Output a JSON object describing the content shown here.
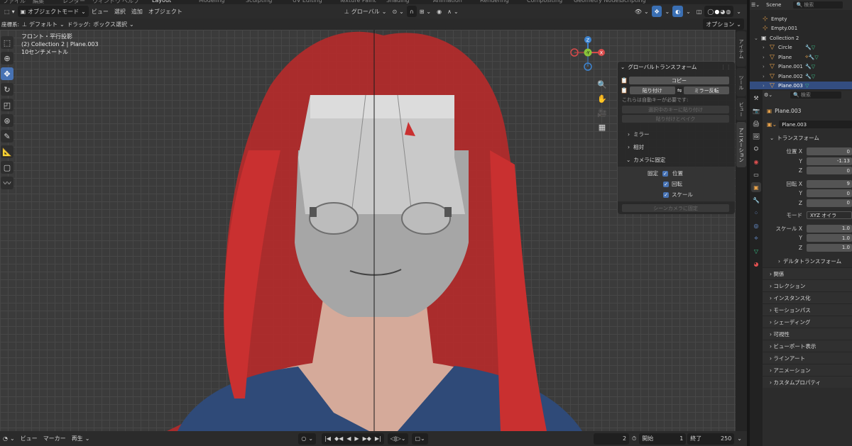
{
  "workspaces": [
    "ファイル",
    "編集",
    "レンダー",
    "ウィンドウ",
    "ヘルプ",
    "Layout",
    "Modeling",
    "Sculpting",
    "UV Editing",
    "Texture Paint",
    "Shading",
    "Animation",
    "Rendering",
    "Compositing",
    "Geometry Nodes",
    "Scripting"
  ],
  "viewport_header": {
    "mode": "オブジェクトモード",
    "menus": [
      "ビュー",
      "選択",
      "追加",
      "オブジェクト"
    ],
    "transform_orientation": "グローバル",
    "options_label": "オプション"
  },
  "tool_header": {
    "orientation_label": "座標系:",
    "orientation_value": "デフォルト",
    "drag_label": "ドラッグ:",
    "drag_value": "ボックス選択"
  },
  "viewport_info": {
    "view_name": "フロント・平行投影",
    "collection_object": "(2) Collection 2 | Plane.003",
    "scale_text": "10センチメートル"
  },
  "gizmo": {
    "z": "Z",
    "y": "-Y",
    "x": "X"
  },
  "npanel": {
    "title": "グローバルトランスフォーム",
    "copy": "コピー",
    "paste": "貼り付け",
    "mirror": "ミラー反転",
    "note": "これらは自動キーが必要です:",
    "paste_selected": "選択中のキーに貼り付け",
    "paste_bake": "貼り付けとベイク",
    "sections": [
      "ミラー",
      "相対",
      "カメラに固定"
    ],
    "fix_label": "固定",
    "checks": [
      "位置",
      "回転",
      "スケール"
    ],
    "scene_camera": "シーンカメラに固定"
  },
  "side_tabs": [
    "アイテム",
    "ツール",
    "ビュー",
    "アニメーション"
  ],
  "timeline": {
    "menus": [
      "ビュー",
      "マーカー"
    ],
    "playback": "再生",
    "current_frame": "2",
    "start_label": "開始",
    "start": "1",
    "end_label": "終了",
    "end": "250"
  },
  "outliner": {
    "scene": "Scene",
    "search_placeholder": "検索",
    "items": [
      {
        "name": "Empty",
        "indent": 2,
        "type": "empty"
      },
      {
        "name": "Empty.001",
        "indent": 2,
        "type": "empty"
      },
      {
        "name": "Collection 2",
        "indent": 1,
        "type": "collection"
      },
      {
        "name": "Circle",
        "indent": 2,
        "type": "mesh"
      },
      {
        "name": "Plane",
        "indent": 2,
        "type": "mesh"
      },
      {
        "name": "Plane.001",
        "indent": 2,
        "type": "mesh"
      },
      {
        "name": "Plane.002",
        "indent": 2,
        "type": "mesh"
      },
      {
        "name": "Plane.003",
        "indent": 2,
        "type": "mesh"
      }
    ]
  },
  "properties": {
    "search_placeholder": "検索",
    "context": "Plane.003",
    "object_name": "Plane.003",
    "transform_title": "トランスフォーム",
    "location_label": "位置 X",
    "loc": [
      "0",
      "-1.13",
      "0"
    ],
    "rotation_label": "回転 X",
    "rot": [
      "9",
      "0",
      "0"
    ],
    "mode_label": "モード",
    "mode_value": "XYZ オイラ",
    "scale_label": "スケール X",
    "scale": [
      "1.0",
      "1.0",
      "1.0"
    ],
    "axis_y": "Y",
    "axis_z": "Z",
    "delta": "デルタトランスフォーム",
    "sections": [
      "関係",
      "コレクション",
      "インスタンス化",
      "モーションパス",
      "シェーディング",
      "可視性",
      "ビューポート表示",
      "ラインアート",
      "アニメーション",
      "カスタムプロパティ"
    ]
  }
}
